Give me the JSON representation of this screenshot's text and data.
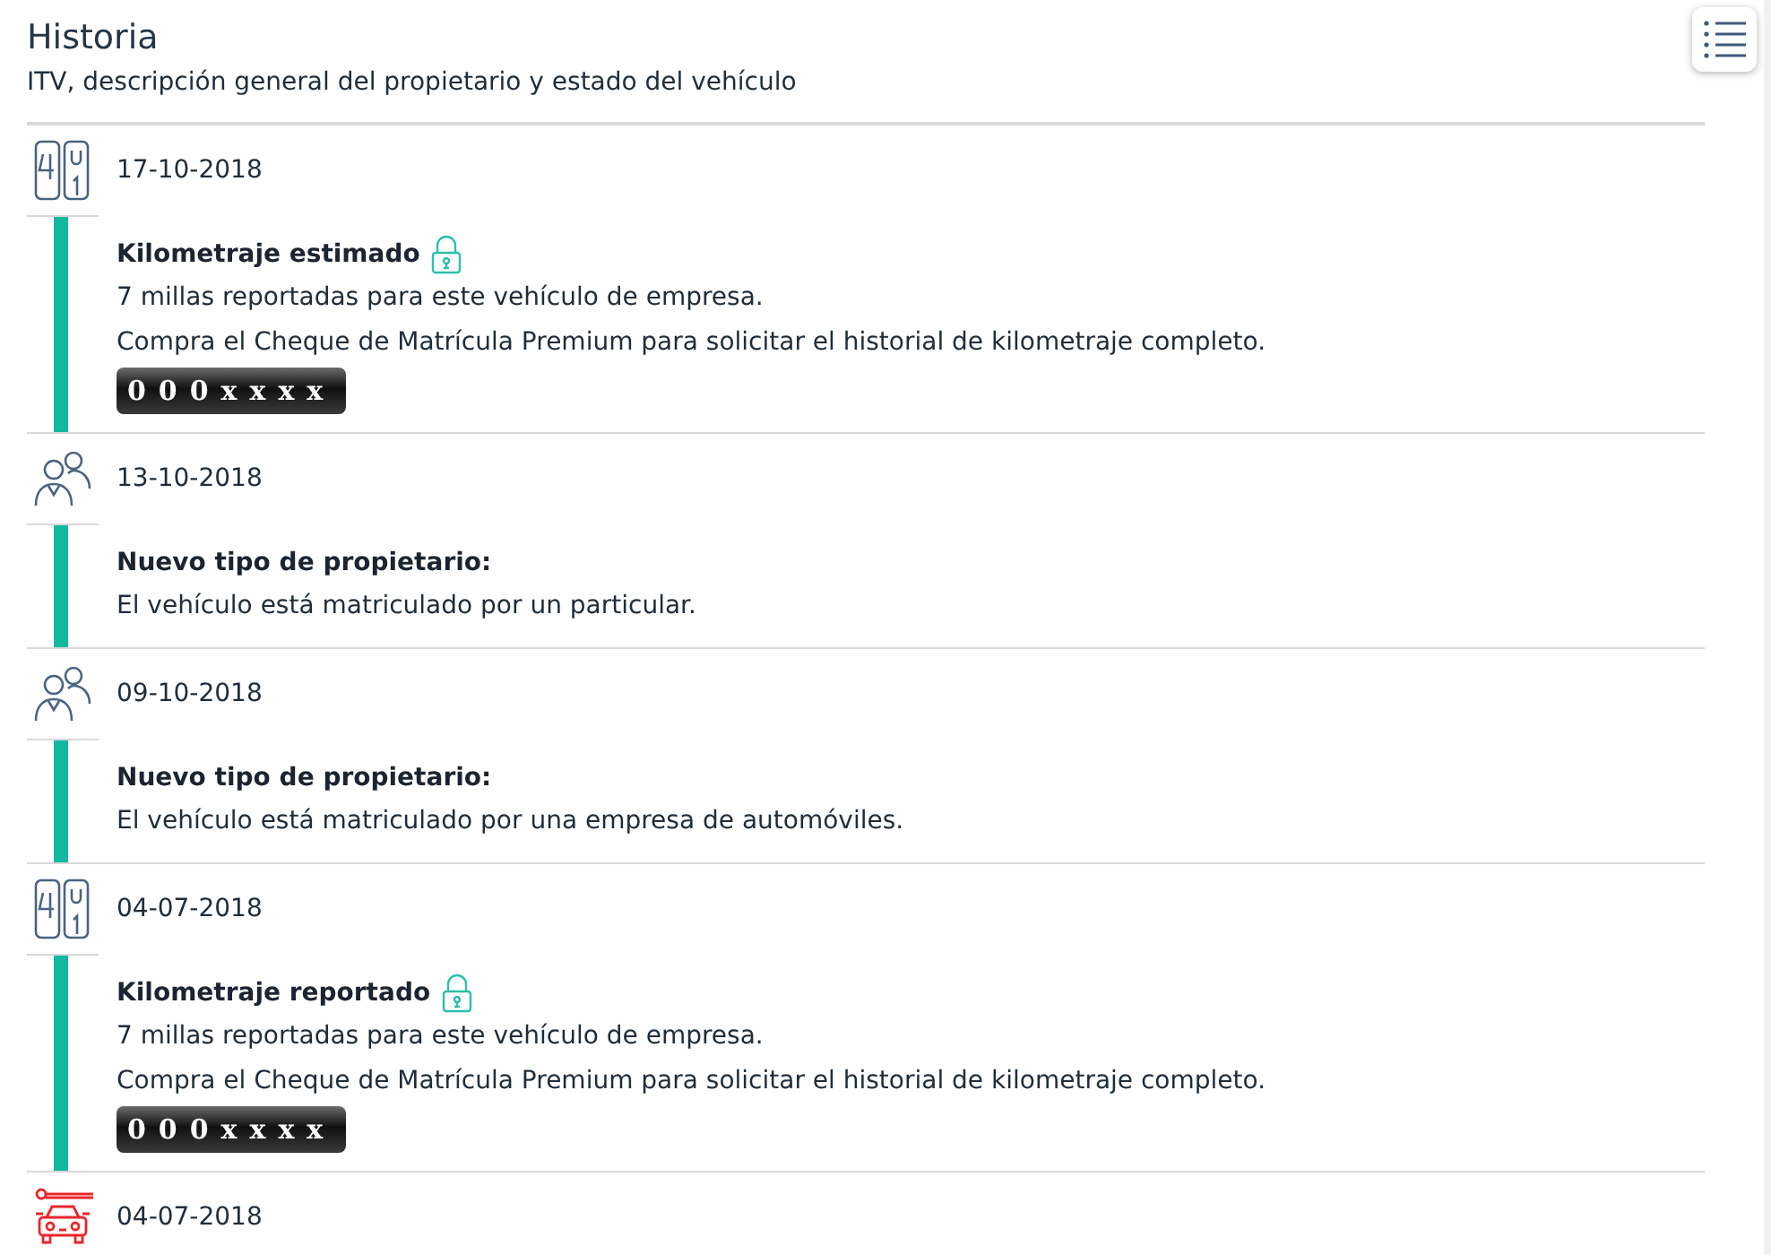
{
  "header": {
    "title": "Historia",
    "subtitle": "ITV, descripción general del propietario y estado del vehículo"
  },
  "entries": [
    {
      "kind": "odometer",
      "date": "17-10-2018",
      "title": "Kilometraje estimado",
      "locked": true,
      "lines": [
        "7 millas reportadas para este vehículo de empresa.",
        "Compra el Cheque de Matrícula Premium para solicitar el historial de kilometraje completo."
      ],
      "reading": "000xxxx"
    },
    {
      "kind": "owners",
      "date": "13-10-2018",
      "title": "Nuevo tipo de propietario:",
      "locked": false,
      "lines": [
        "El vehículo está matriculado por un particular."
      ]
    },
    {
      "kind": "owners",
      "date": "09-10-2018",
      "title": "Nuevo tipo de propietario:",
      "locked": false,
      "lines": [
        "El vehículo está matriculado por una empresa de automóviles."
      ]
    },
    {
      "kind": "odometer",
      "date": "04-07-2018",
      "title": "Kilometraje reportado",
      "locked": true,
      "lines": [
        "7 millas reportadas para este vehículo de empresa.",
        "Compra el Cheque de Matrícula Premium para solicitar el historial de kilometraje completo."
      ],
      "reading": "000xxxx"
    },
    {
      "kind": "service",
      "date": "04-07-2018"
    }
  ]
}
